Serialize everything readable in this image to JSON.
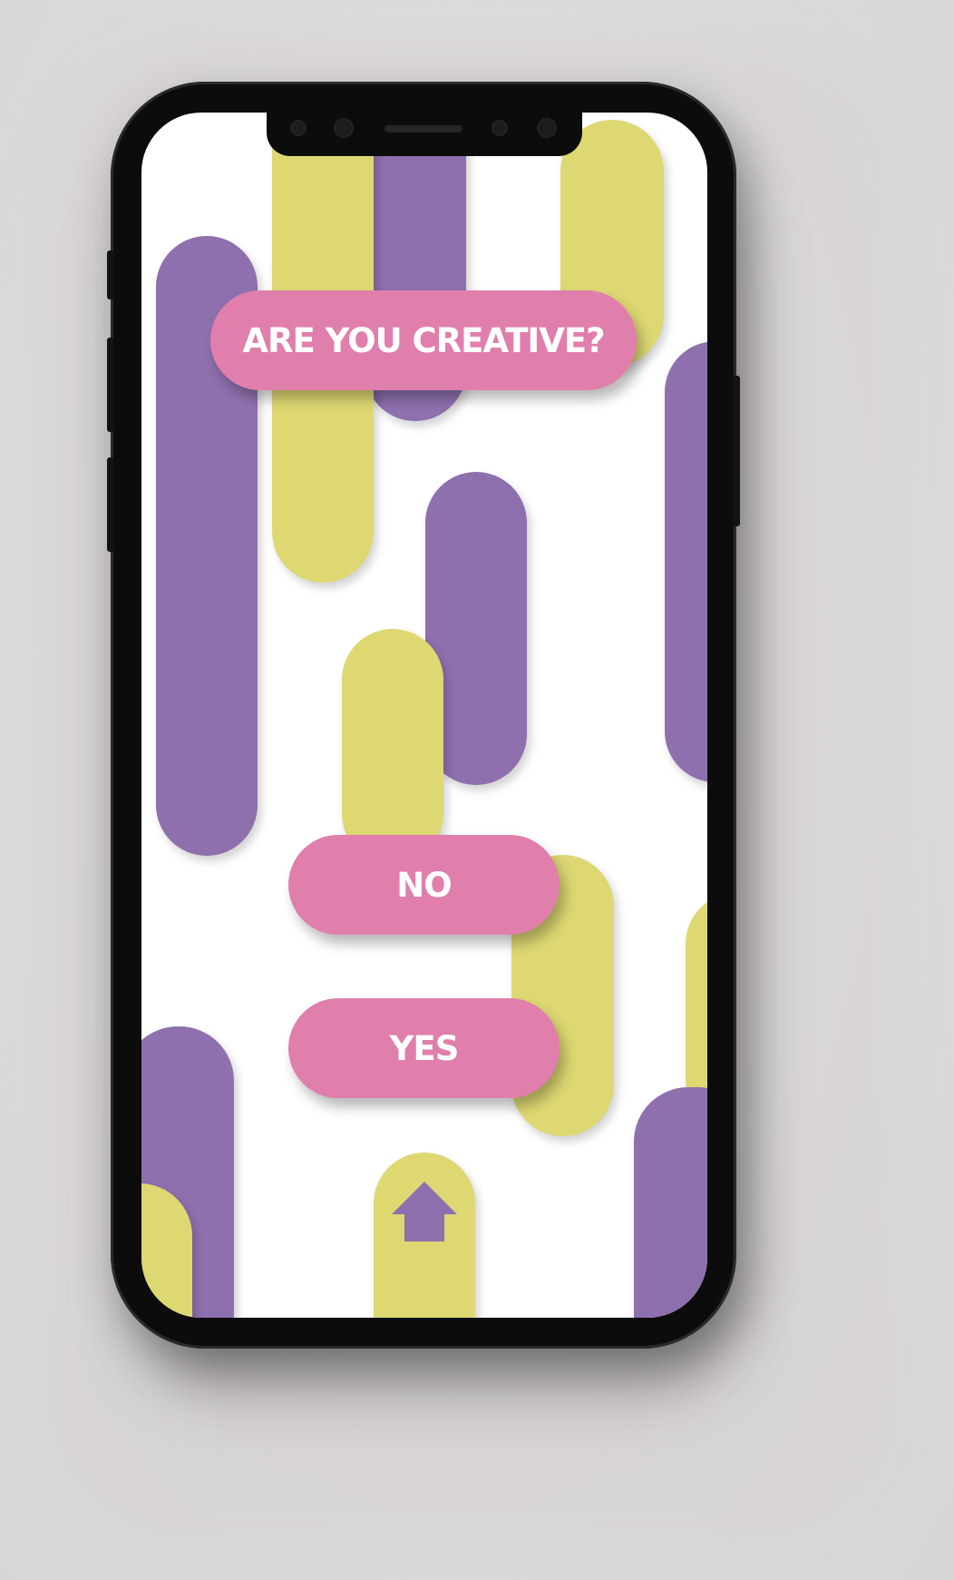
{
  "question": {
    "text": "ARE YOU CREATIVE?"
  },
  "answers": {
    "no_label": "NO",
    "yes_label": "YES"
  },
  "home": {
    "icon": "home-up-arrow-icon"
  },
  "colors": {
    "pink": "#e07fac",
    "purple": "#8e70ae",
    "yellow": "#ddd872",
    "screen_background": "#ffffff",
    "phone_frame": "#0c0c0c"
  }
}
